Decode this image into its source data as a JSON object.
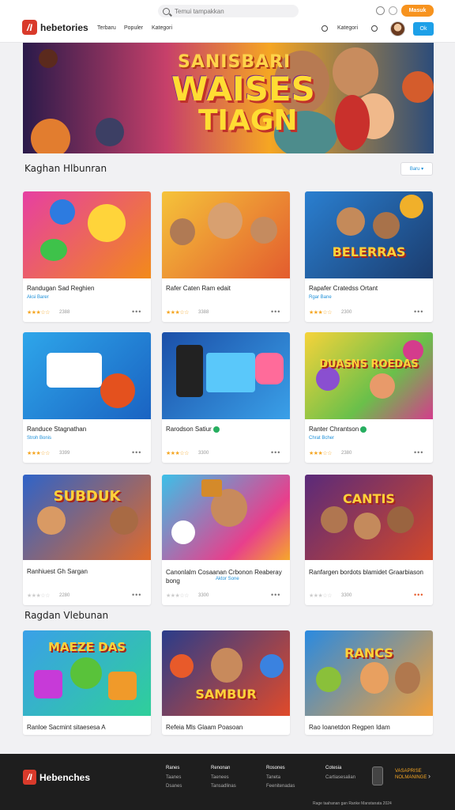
{
  "header": {
    "search_placeholder": "Temui tampakkan",
    "signin_label": "Masuk",
    "logo_text": "hebetories",
    "nav": [
      "Terbaru",
      "Populer",
      "Kategori"
    ],
    "right_link": "Kategori",
    "blue_button": "Ok"
  },
  "hero": {
    "kicker": "SANISBARI",
    "title_line1": "WAISES",
    "title_line2": "TIAGN"
  },
  "sections": [
    {
      "title": "Kaghan Hlbunran",
      "filter_label": "Baru"
    },
    {
      "title": "Ragdan Vlebunan"
    }
  ],
  "cards": [
    {
      "title": "Randugan Sad Reghien",
      "category": "Aksi Barer",
      "plays": "2388"
    },
    {
      "title": "Rafer Caten Ram edait",
      "category": "",
      "plays": "3388"
    },
    {
      "title": "Rapafer Cratedss Ortant",
      "category": "Rgar Bane",
      "plays": "2300"
    },
    {
      "title": "Randuce Stagnathan",
      "category": "Stroh Bonis",
      "plays": "3399"
    },
    {
      "title": "Rarodson Satiur",
      "category": "",
      "plays": "3300"
    },
    {
      "title": "Ranter Chrantson",
      "category": "Chrat Bcher",
      "plays": "2380"
    },
    {
      "title": "Ranhiuest Gh Sargan",
      "category": "",
      "plays": "2280"
    },
    {
      "title": "Canonlalm Cosaanan Crbonon Reaberay bong",
      "category": "Aktor Sone",
      "plays": "3300"
    },
    {
      "title": "Ranfargen bordots blamidet Graarbiason",
      "category": "",
      "plays": "3300"
    },
    {
      "title": "Ranloe Sacmint sitaesesa A",
      "category": "",
      "plays": ""
    },
    {
      "title": "Refeia Mls Glaam Poasoan",
      "category": "",
      "plays": ""
    },
    {
      "title": "Rao Ioanetdon Regpen Idam",
      "category": "",
      "plays": ""
    }
  ],
  "card_art": [
    "",
    "",
    "BELERRAS",
    "",
    "",
    "DUASNS ROEDAS",
    "SUBDUK",
    "",
    "CANTIS",
    "MAEZE DAS",
    "SAMBUR",
    "RANCS"
  ],
  "footer": {
    "logo_text": "Hebenches",
    "columns": [
      {
        "heading": "Ranes",
        "links": [
          "Taanes",
          "Dsanes"
        ]
      },
      {
        "heading": "Renonan",
        "links": [
          "Taenees",
          "Tansadlinas"
        ]
      },
      {
        "heading": "Rosones",
        "links": [
          "Taneta",
          "Feenitenadas"
        ]
      },
      {
        "heading": "Cotesia",
        "links": [
          "Cartiasesalian"
        ]
      }
    ],
    "badge_line1": "VASAPRISE",
    "badge_line2": "NOLMANINGE",
    "copyright": "Rage taahanan gan Ranke Manstanata 2024"
  },
  "colors": {
    "accent_orange": "#f7931e",
    "accent_blue": "#1da0e8",
    "brand_red": "#d93a2b",
    "star": "#f5a623"
  }
}
